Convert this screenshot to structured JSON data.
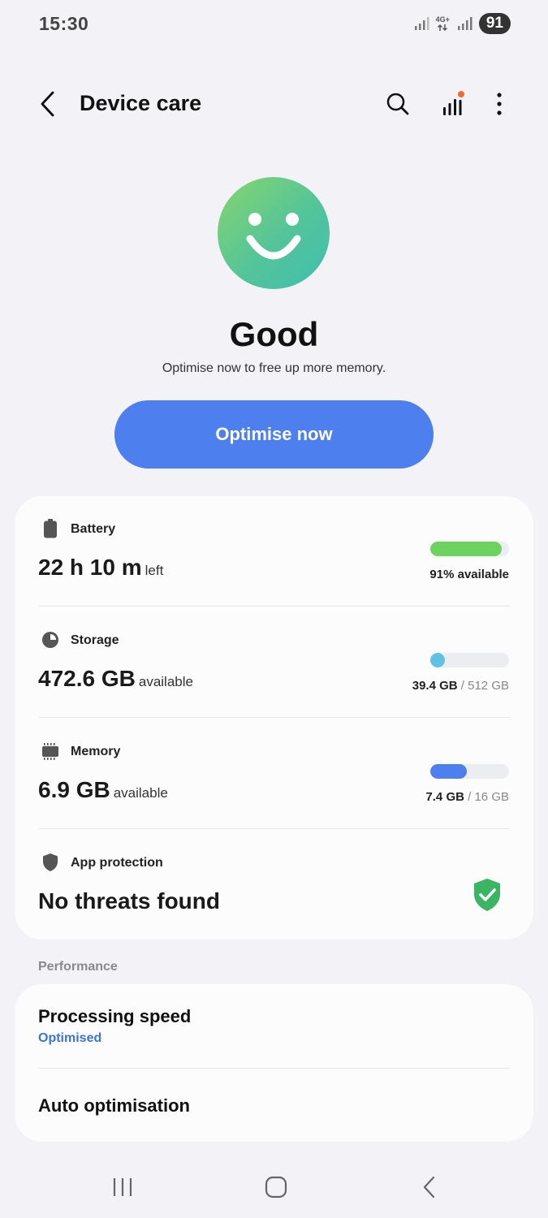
{
  "status_bar": {
    "time": "15:30",
    "network_label": "4G+",
    "battery_level": "91"
  },
  "header": {
    "title": "Device care"
  },
  "hero": {
    "status": "Good",
    "subtitle": "Optimise now to free up more memory.",
    "button_label": "Optimise now"
  },
  "battery": {
    "label": "Battery",
    "value": "22 h 10 m",
    "unit": "left",
    "level_fraction": 0.91,
    "meta": "91% available",
    "color": "#6dd35f"
  },
  "storage": {
    "label": "Storage",
    "value": "472.6 GB",
    "unit": "available",
    "used": "39.4 GB",
    "separator": " / ",
    "total": "512 GB",
    "used_fraction": 0.077,
    "color": "#5ec3e2"
  },
  "memory": {
    "label": "Memory",
    "value": "6.9 GB",
    "unit": "available",
    "used": "7.4 GB",
    "separator": " / ",
    "total": "16 GB",
    "used_fraction": 0.4625,
    "color": "#4e7fef"
  },
  "app_protection": {
    "label": "App protection",
    "value": "No threats found",
    "shield_color": "#3bb563"
  },
  "performance": {
    "section_label": "Performance",
    "items": [
      {
        "title": "Processing speed",
        "subtitle": "Optimised"
      },
      {
        "title": "Auto optimisation"
      }
    ]
  },
  "colors": {
    "accent": "#4e7fef",
    "background": "#f3f2f7",
    "card": "#fcfcfd"
  }
}
